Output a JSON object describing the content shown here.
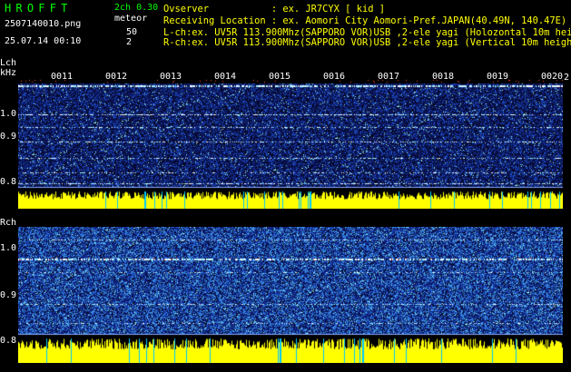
{
  "header": {
    "app_name": "HROFFT",
    "version": "2ch 0.30",
    "mode": "meteor",
    "file_name": "2507140010.png",
    "date_time": "25.07.14 00:10",
    "l_value": "50",
    "r_value": "2",
    "info_lines": [
      "Ovserver           : ex. JR7CYX [ kid ]",
      "Receiving Location : ex. Aomori City Aomori-Pref.JAPAN(40.49N, 140.47E)",
      "L-ch:ex. UV5R 113.900Mhz(SAPPORO VOR)USB ,2-ele yagi (Holozontal 10m height)",
      "R-ch:ex. UV5R 113.900Mhz(SAPPORO VOR)USB ,2-ele yagi (Vertical 10m height)"
    ]
  },
  "left_panel": {
    "label": "Lch",
    "unit": "kHz",
    "y_ticks": [
      "1.0",
      "0.9",
      "0.8"
    ],
    "time_labels": [
      "0011",
      "0012",
      "0013",
      "0014",
      "0015",
      "0016",
      "0017",
      "0018",
      "0019",
      "0020"
    ],
    "right_edge_label": "2"
  },
  "right_panel": {
    "label": "Rch",
    "y_ticks": [
      "1.0",
      "0.9",
      "0.8"
    ]
  },
  "colors": {
    "title_green": "#00ff00",
    "info_yellow": "#ffff00",
    "noise_low": "#0a1a6e",
    "noise_mid": "#2f6fe0",
    "noise_high": "#33d8d0",
    "signal_line": "#ffffff",
    "meteor_red": "#ff4030",
    "audio_bar": "#ffff00"
  }
}
